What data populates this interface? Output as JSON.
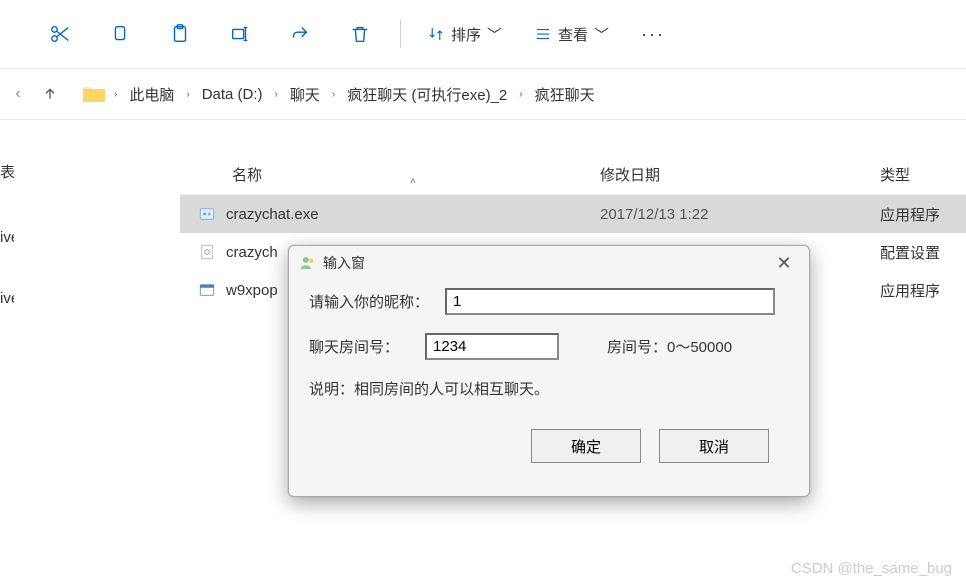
{
  "toolbar": {
    "sort_label": "排序",
    "view_label": "查看"
  },
  "breadcrumb": {
    "items": [
      "此电脑",
      "Data (D:)",
      "聊天",
      "疯狂聊天 (可执行exe)_2",
      "疯狂聊天"
    ]
  },
  "sidebar": {
    "items": [
      "表",
      "ive",
      "ive"
    ]
  },
  "headers": {
    "name": "名称",
    "date": "修改日期",
    "type": "类型"
  },
  "rows": [
    {
      "name": "crazychat.exe",
      "date": "2017/12/13 1:22",
      "type": "应用程序",
      "selected": true
    },
    {
      "name": "crazych",
      "date": "",
      "type": "配置设置",
      "selected": false
    },
    {
      "name": "w9xpop",
      "date": "",
      "type": "应用程序",
      "selected": false
    }
  ],
  "dialog": {
    "title": "输入窗",
    "nickname_label": "请输入你的昵称：",
    "nickname_value": "1",
    "room_label": "聊天房间号：",
    "room_value": "1234",
    "room_hint": "房间号：0～50000",
    "desc": "说明：相同房间的人可以相互聊天。",
    "ok": "确定",
    "cancel": "取消"
  },
  "watermark": "CSDN @the_same_bug"
}
